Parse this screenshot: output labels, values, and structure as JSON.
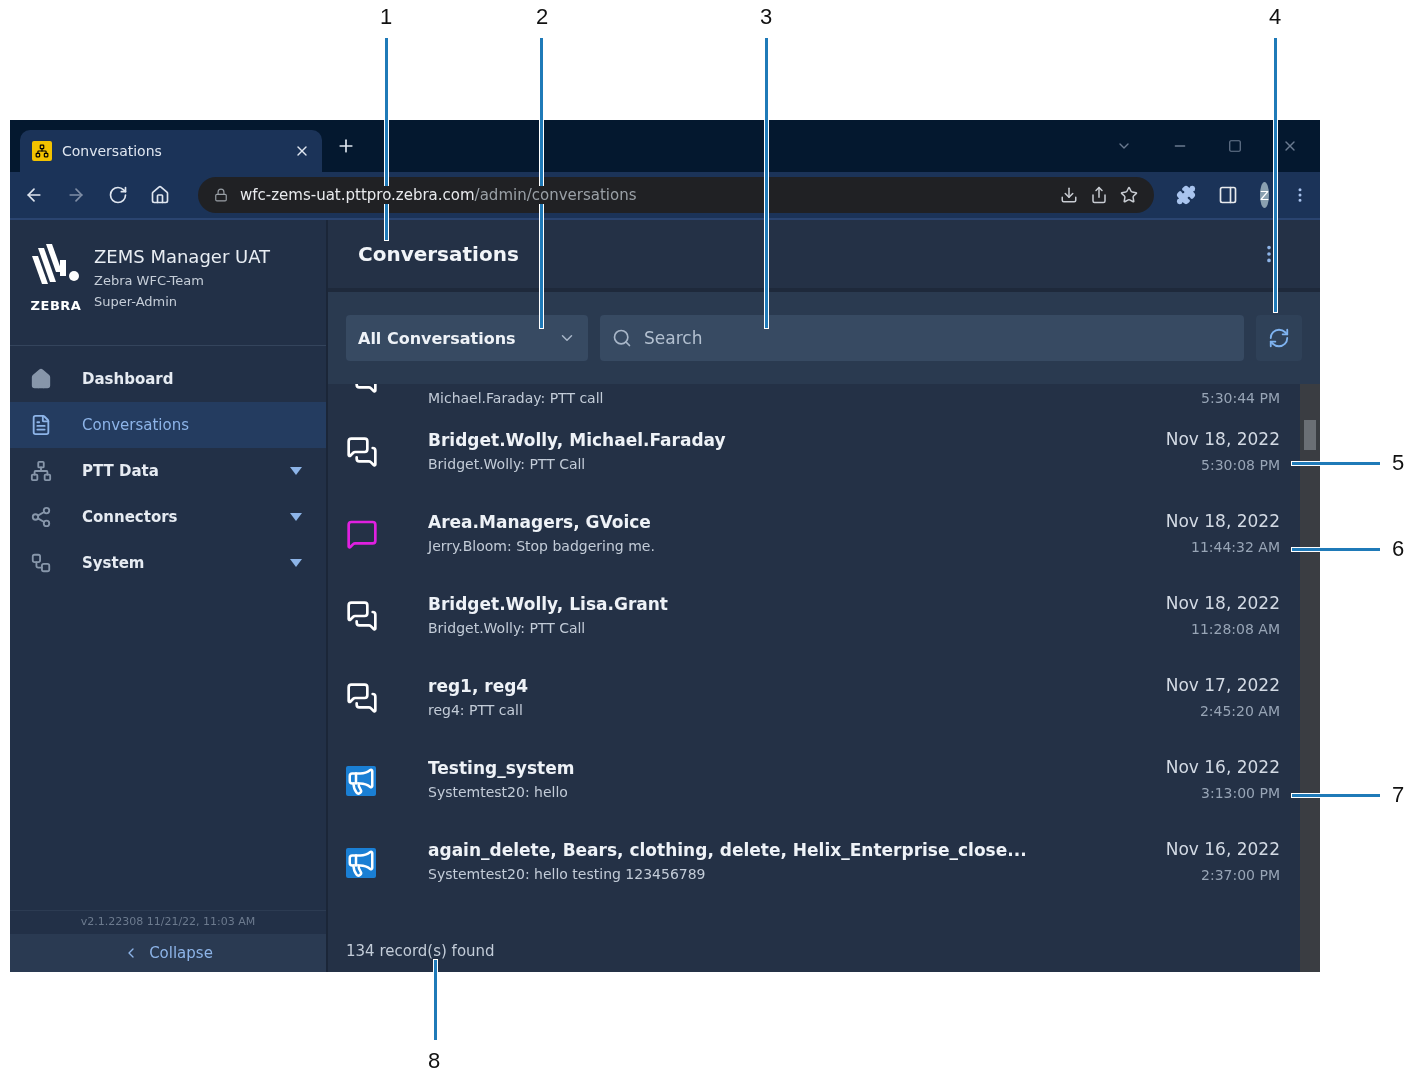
{
  "callouts": [
    {
      "label": "1"
    },
    {
      "label": "2"
    },
    {
      "label": "3"
    },
    {
      "label": "4"
    },
    {
      "label": "5"
    },
    {
      "label": "6"
    },
    {
      "label": "7"
    },
    {
      "label": "8"
    }
  ],
  "browser": {
    "tab": {
      "title": "Conversations"
    },
    "url_host": "wfc-zems-uat.pttpro.zebra.com",
    "url_path": "/admin/conversations",
    "avatar": "Z"
  },
  "sidebar": {
    "brand": "ZEBRA",
    "app_name": "ZEMS Manager UAT",
    "team": "Zebra WFC-Team",
    "role": "Super-Admin",
    "items": [
      {
        "label": "Dashboard",
        "selected": false,
        "expandable": false
      },
      {
        "label": "Conversations",
        "selected": true,
        "expandable": false
      },
      {
        "label": "PTT Data",
        "selected": false,
        "expandable": true
      },
      {
        "label": "Connectors",
        "selected": false,
        "expandable": true
      },
      {
        "label": "System",
        "selected": false,
        "expandable": true
      }
    ],
    "version": "v2.1.22308 11/21/22, 11:03 AM",
    "collapse": "Collapse"
  },
  "main": {
    "title": "Conversations",
    "filter": "All Conversations",
    "search_placeholder": "Search",
    "rows": [
      {
        "kind": "chat",
        "partial": true,
        "subtitle": "Michael.Faraday: PTT call",
        "time": "5:30:44 PM"
      },
      {
        "kind": "chat",
        "partial": false,
        "title": "Bridget.Wolly, Michael.Faraday",
        "subtitle": "Bridget.Wolly: PTT Call",
        "date": "Nov 18, 2022",
        "time": "5:30:08 PM"
      },
      {
        "kind": "voice",
        "partial": false,
        "title": "Area.Managers, GVoice",
        "subtitle": "Jerry.Bloom: Stop badgering me.",
        "date": "Nov 18, 2022",
        "time": "11:44:32 AM"
      },
      {
        "kind": "chat",
        "partial": false,
        "title": "Bridget.Wolly, Lisa.Grant",
        "subtitle": "Bridget.Wolly: PTT Call",
        "date": "Nov 18, 2022",
        "time": "11:28:08 AM"
      },
      {
        "kind": "chat",
        "partial": false,
        "title": "reg1, reg4",
        "subtitle": "reg4: PTT call",
        "date": "Nov 17, 2022",
        "time": "2:45:20 AM"
      },
      {
        "kind": "broadcast",
        "partial": false,
        "title": "Testing_system",
        "subtitle": "Systemtest20: hello",
        "date": "Nov 16, 2022",
        "time": "3:13:00 PM"
      },
      {
        "kind": "broadcast",
        "partial": false,
        "title": "again_delete, Bears, clothing, delete, Helix_Enterprise_close...",
        "subtitle": "Systemtest20: hello testing 123456789",
        "date": "Nov 16, 2022",
        "time": "2:37:00 PM"
      }
    ],
    "footer": "134 record(s) found"
  }
}
